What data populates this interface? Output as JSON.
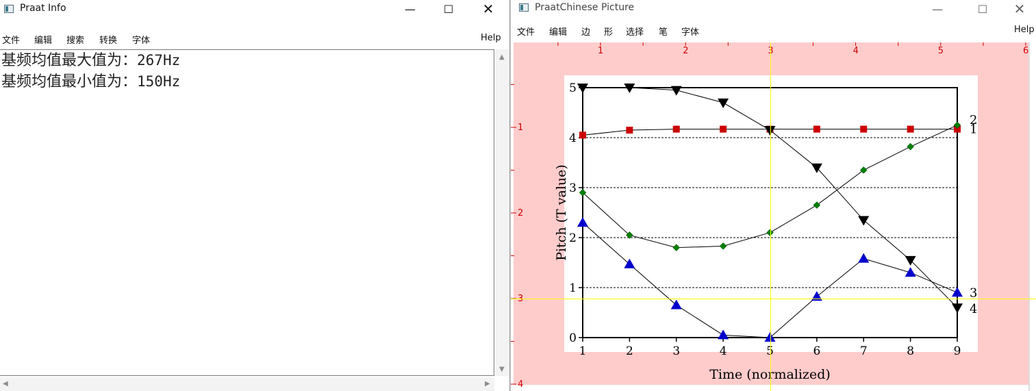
{
  "info_window": {
    "title": "Praat Info",
    "menu": [
      "文件",
      "编辑",
      "搜索",
      "转换",
      "字体"
    ],
    "help": "Help",
    "lines": [
      {
        "label": "基频均值最大值为：",
        "value": "267Hz"
      },
      {
        "label": "基频均值最小值为：",
        "value": "150Hz"
      }
    ]
  },
  "picture_window": {
    "title": "PraatChinese Picture",
    "menu": [
      "文件",
      "编辑",
      "边",
      "形",
      "选择",
      "笔",
      "字体"
    ],
    "help": "Help",
    "ruler_top": [
      "1",
      "2",
      "3",
      "4",
      "5",
      "6"
    ],
    "ruler_left": [
      "1",
      "2",
      "3",
      "4"
    ],
    "colors": {
      "selection": "#ffcccc",
      "crosshair": "#ffff00",
      "ruler": "#cc0000"
    }
  },
  "chart_data": {
    "type": "line",
    "xlabel": "Time (normalized)",
    "ylabel": "Pitch (T value)",
    "xlim": [
      1,
      9
    ],
    "ylim": [
      0,
      5
    ],
    "xticks": [
      "1",
      "2",
      "3",
      "4",
      "5",
      "6",
      "7",
      "8",
      "9"
    ],
    "yticks": [
      "0",
      "1",
      "2",
      "3",
      "4",
      "5"
    ],
    "gridlines_y": [
      1,
      2,
      3,
      4
    ],
    "x": [
      1,
      2,
      3,
      4,
      5,
      6,
      7,
      8,
      9
    ],
    "series": [
      {
        "label": "1",
        "marker": "square",
        "color": "#cc0000",
        "values": [
          4.05,
          4.15,
          4.17,
          4.17,
          4.17,
          4.17,
          4.17,
          4.17,
          4.17
        ]
      },
      {
        "label": "2",
        "marker": "diamond",
        "color": "#008000",
        "values": [
          2.9,
          2.05,
          1.8,
          1.83,
          2.1,
          2.65,
          3.35,
          3.82,
          4.25
        ]
      },
      {
        "label": "3",
        "marker": "triangle-up",
        "color": "#0000cc",
        "values": [
          2.3,
          1.47,
          0.65,
          0.05,
          0.0,
          0.82,
          1.58,
          1.3,
          0.9
        ]
      },
      {
        "label": "4",
        "marker": "triangle-down",
        "color": "#000000",
        "values": [
          5.0,
          5.0,
          4.95,
          4.7,
          4.15,
          3.4,
          2.35,
          1.55,
          0.6
        ]
      }
    ]
  }
}
